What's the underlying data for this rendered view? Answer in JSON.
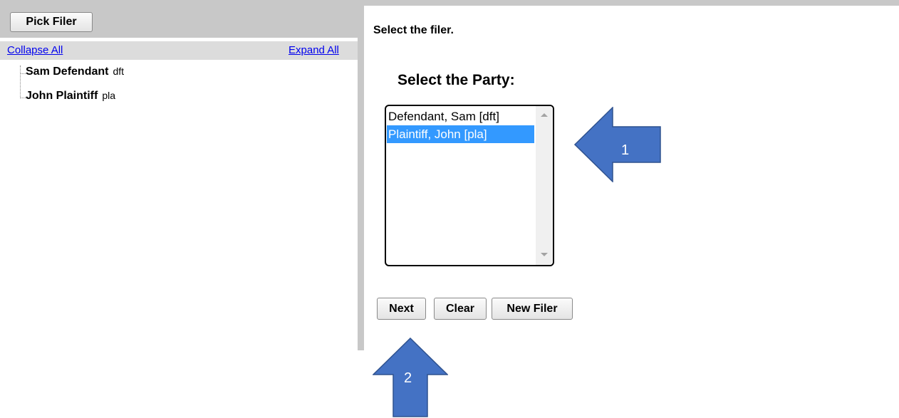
{
  "filer_tree": {
    "pick_button_label": "Pick Filer",
    "collapse_all": "Collapse All",
    "expand_all": "Expand All",
    "items": [
      {
        "name": "Sam Defendant",
        "role": "dft"
      },
      {
        "name": "John Plaintiff",
        "role": "pla"
      }
    ]
  },
  "main": {
    "instruction": "Select the filer.",
    "party_heading": "Select the Party:",
    "party_options": [
      {
        "label": "Defendant, Sam [dft]",
        "selected": false
      },
      {
        "label": "Plaintiff, John [pla]",
        "selected": true
      }
    ],
    "buttons": {
      "next": "Next",
      "clear": "Clear",
      "new_filer": "New Filer"
    }
  },
  "annotations": {
    "arrow_1_label": "1",
    "arrow_2_label": "2",
    "arrow_color": "#4472c4",
    "arrow_border_color": "#2f528f"
  },
  "colors": {
    "selection": "#3399ff",
    "panel_gray": "#c8c8c8",
    "link": "#0000ee"
  }
}
